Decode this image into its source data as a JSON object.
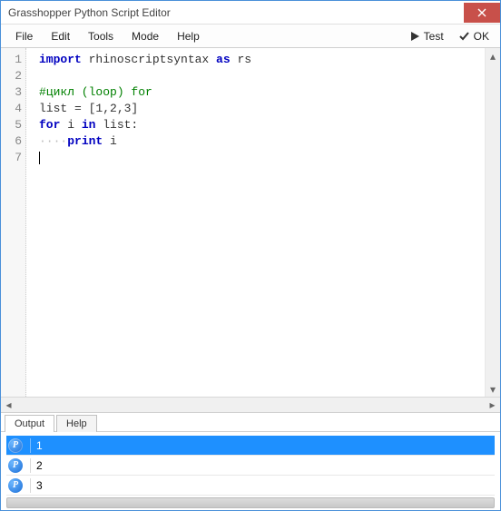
{
  "window": {
    "title": "Grasshopper Python Script Editor"
  },
  "menu": {
    "items": [
      "File",
      "Edit",
      "Tools",
      "Mode",
      "Help"
    ]
  },
  "toolbar": {
    "test_label": "Test",
    "ok_label": "OK"
  },
  "editor": {
    "line_numbers": [
      "1",
      "2",
      "3",
      "4",
      "5",
      "6",
      "7"
    ],
    "code": {
      "l1_kw1": "import",
      "l1_mid": " rhinoscriptsyntax ",
      "l1_kw2": "as",
      "l1_end": " rs",
      "l3_comment": "#цикл (loop) for",
      "l4": "list = [1,2,3]",
      "l5_kw1": "for",
      "l5_mid": " i ",
      "l5_kw2": "in",
      "l5_end": " list:",
      "l6_ws": "····",
      "l6_kw": "print",
      "l6_end": " i"
    }
  },
  "bottom_tabs": {
    "output": "Output",
    "help": "Help",
    "active": "output"
  },
  "output": {
    "rows": [
      {
        "value": "1",
        "selected": true
      },
      {
        "value": "2",
        "selected": false
      },
      {
        "value": "3",
        "selected": false
      }
    ]
  }
}
